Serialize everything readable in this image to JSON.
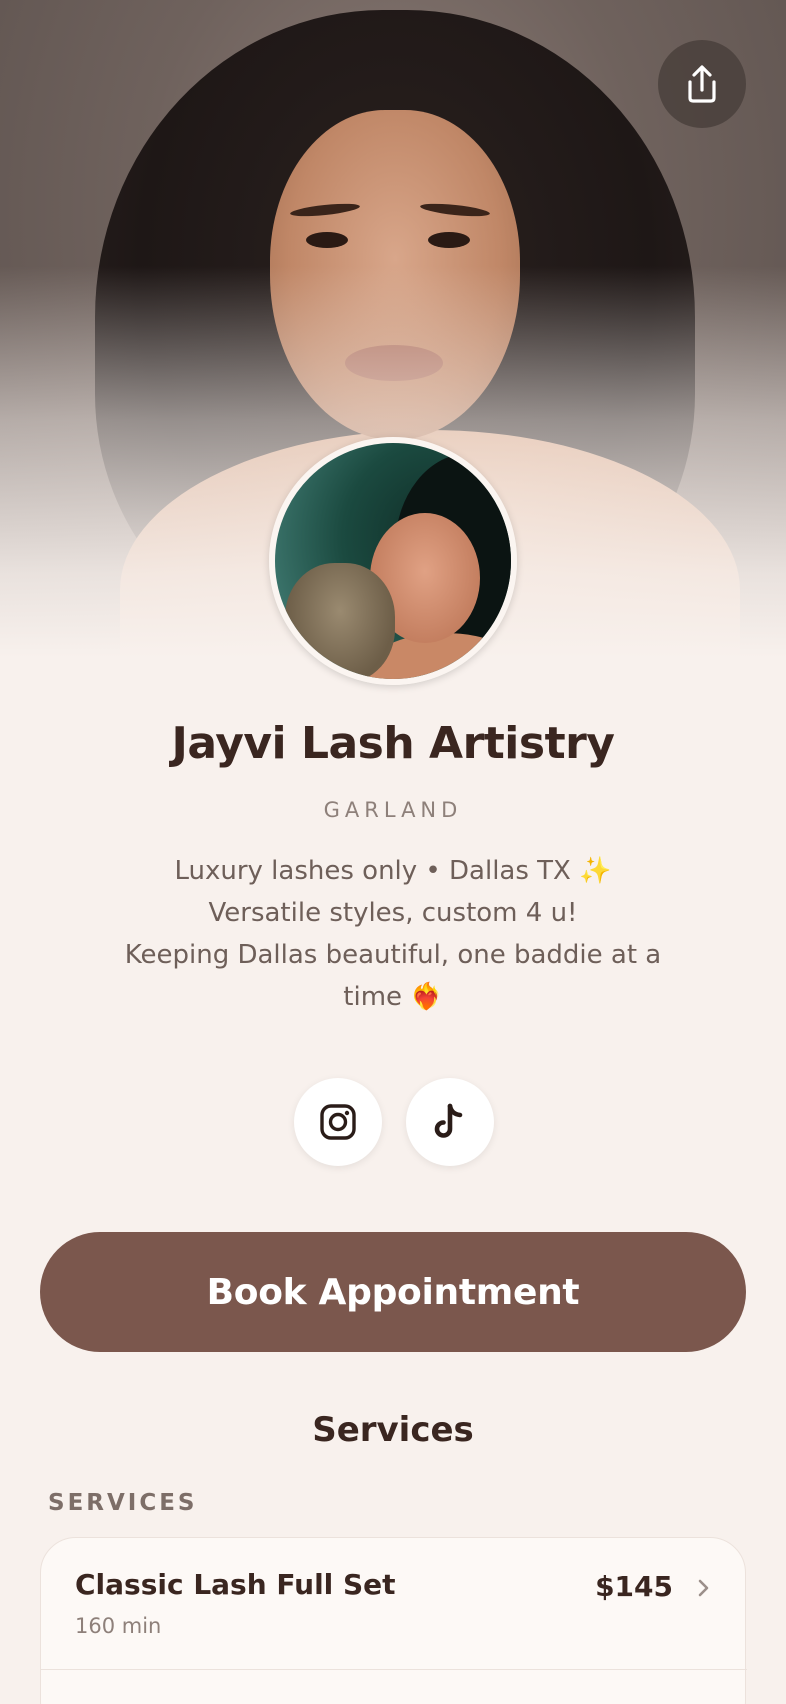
{
  "profile": {
    "name": "Jayvi Lash Artistry",
    "location": "GARLAND",
    "bio_lines": [
      "Luxury lashes only • Dallas TX ✨",
      "Versatile styles, custom 4 u!",
      "Keeping Dallas beautiful, one baddie at a",
      "time ❤️‍🔥"
    ]
  },
  "actions": {
    "share_icon": "share-icon",
    "book_label": "Book Appointment"
  },
  "socials": [
    {
      "icon": "instagram-icon"
    },
    {
      "icon": "tiktok-icon"
    }
  ],
  "services": {
    "heading": "Services",
    "category": "SERVICES",
    "items": [
      {
        "name": "Classic Lash Full Set",
        "duration": "160 min",
        "price": "$145"
      }
    ]
  },
  "colors": {
    "background": "#f8f1ed",
    "accent": "#7b574d",
    "text": "#3a2620",
    "muted": "#8e807a"
  }
}
